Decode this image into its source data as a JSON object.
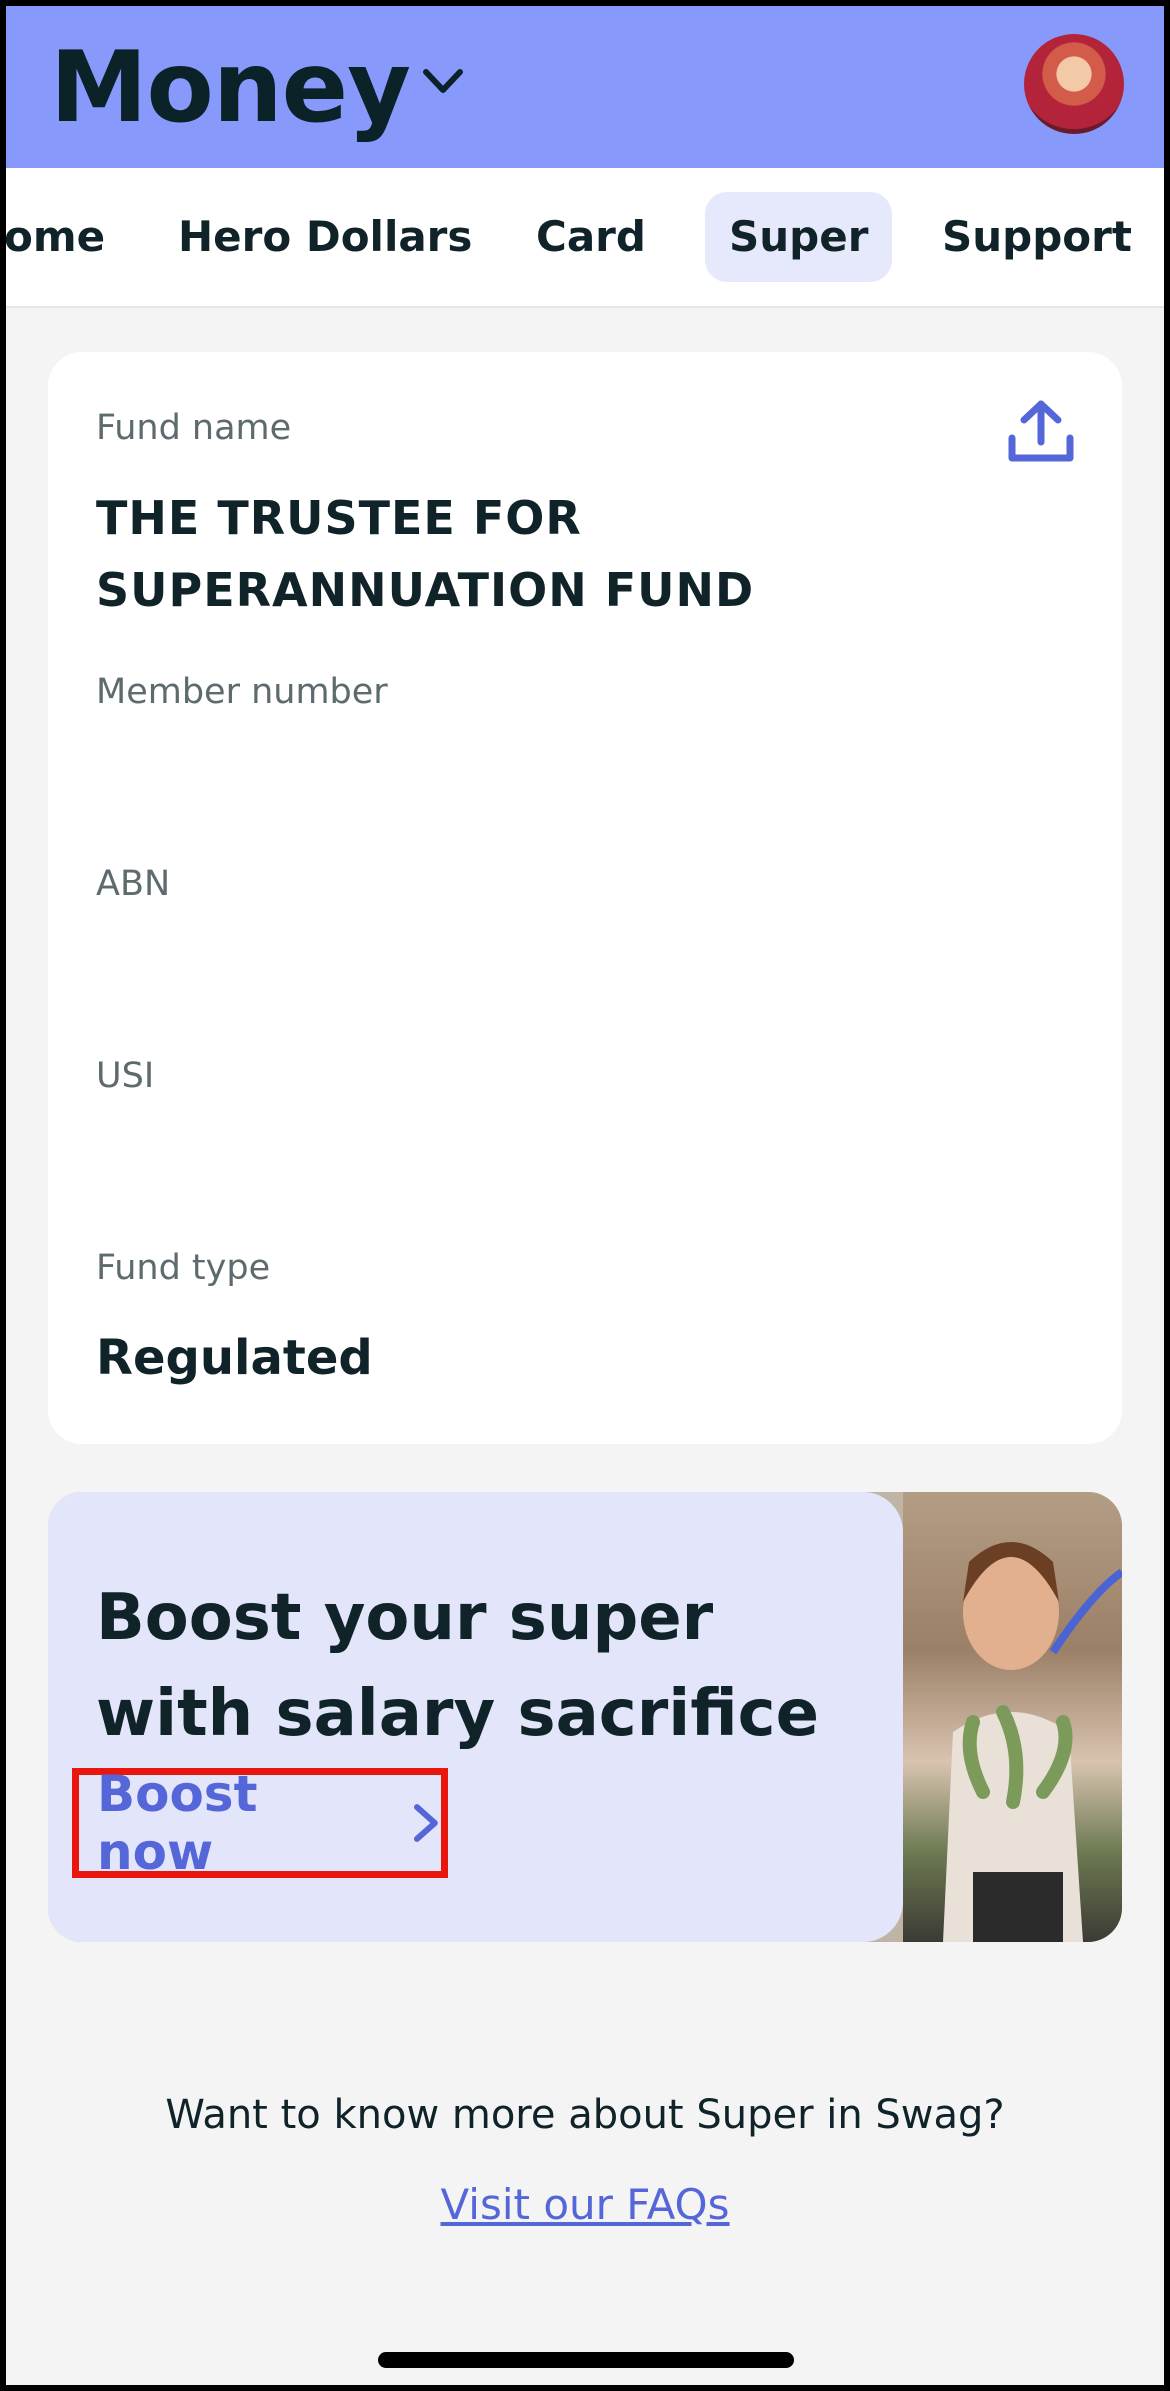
{
  "header": {
    "title": "Money",
    "avatar": "avatar"
  },
  "tabs": [
    {
      "label": "ome",
      "active": false
    },
    {
      "label": "Hero Dollars",
      "active": false
    },
    {
      "label": "Card",
      "active": false
    },
    {
      "label": "Super",
      "active": true
    },
    {
      "label": "Support",
      "active": false
    }
  ],
  "fund": {
    "fund_name_label": "Fund name",
    "fund_name": "THE TRUSTEE FOR SUPERANNUATION FUND",
    "member_number_label": "Member number",
    "abn_label": "ABN",
    "usi_label": "USI",
    "fund_type_label": "Fund type",
    "fund_type": "Regulated",
    "share_icon": "share-upload-icon"
  },
  "promo": {
    "headline": "Boost your super with salary sacrifice",
    "cta": "Boost now"
  },
  "footer": {
    "question": "Want to know more about Super in Swag?",
    "link": "Visit our FAQs"
  },
  "colors": {
    "header_bg": "#8899fc",
    "accent": "#5466d8",
    "promo_bg": "#e3e6fb",
    "highlight_border": "#e8160c"
  }
}
